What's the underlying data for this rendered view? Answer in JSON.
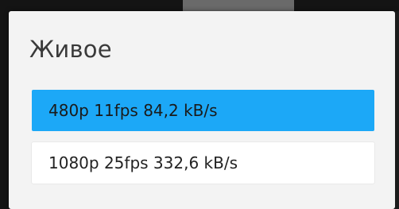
{
  "dialog": {
    "title": "Живое",
    "options": [
      {
        "label": "480p 11fps 84,2 kB/s",
        "selected": true
      },
      {
        "label": "1080p 25fps 332,6 kB/s",
        "selected": false
      }
    ]
  },
  "colors": {
    "selected": "#1ca8f7",
    "dialog_background": "#f3f3f3",
    "option_background": "#ffffff"
  }
}
